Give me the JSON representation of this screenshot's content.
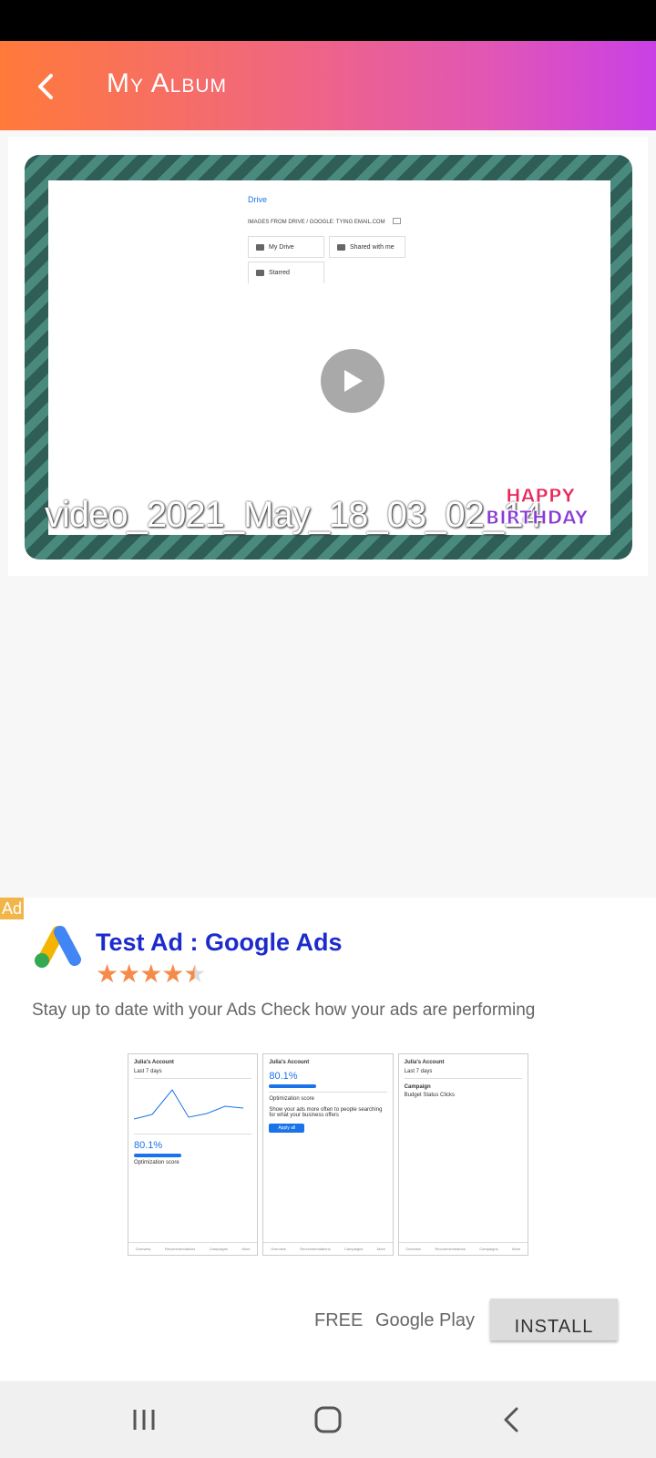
{
  "app_bar": {
    "title": "My Album",
    "back_icon": "chevron-left-icon"
  },
  "video": {
    "name": "video_2021_May_18_03_02_14",
    "play_icon": "play-icon",
    "preview": {
      "drive_label": "Drive",
      "path": "IMAGES FROM DRIVE / GOOGLE: TYING EMAIL.COM",
      "folders": [
        "My Drive",
        "Shared with me",
        "Starred"
      ]
    },
    "sticker_text": [
      "HAPPY",
      "BIRTHDAY"
    ]
  },
  "ad": {
    "badge": "Ad",
    "title": "Test Ad : Google Ads",
    "rating": 4.5,
    "stars": "★★★★",
    "description": "Stay up to date with your Ads Check how your ads are performing",
    "price": "FREE",
    "store": "Google Play",
    "install_label": "INSTALL",
    "screens": [
      {
        "account": "Julia's Account",
        "subtitle": "Last 7 days",
        "metric": "80.1%",
        "metric_label": "Optimization score"
      },
      {
        "account": "Julia's Account",
        "subtitle": "Optimization score",
        "metric": "80.1%",
        "metric_label": "Show your ads more often to people searching for what your business offers",
        "button": "Apply all"
      },
      {
        "account": "Julia's Account",
        "subtitle": "Last 7 days",
        "metric": "Campaign",
        "metric_label": "Budget  Status  Clicks"
      }
    ]
  },
  "colors": {
    "accent_orange": "#ff7a3a",
    "accent_purple": "#c940e6",
    "ad_title": "#1d2bcc",
    "star": "#f58b4a",
    "ad_badge": "#f2b54a"
  },
  "nav": {
    "recents_icon": "recents-icon",
    "home_icon": "home-icon",
    "back_icon": "back-icon"
  }
}
